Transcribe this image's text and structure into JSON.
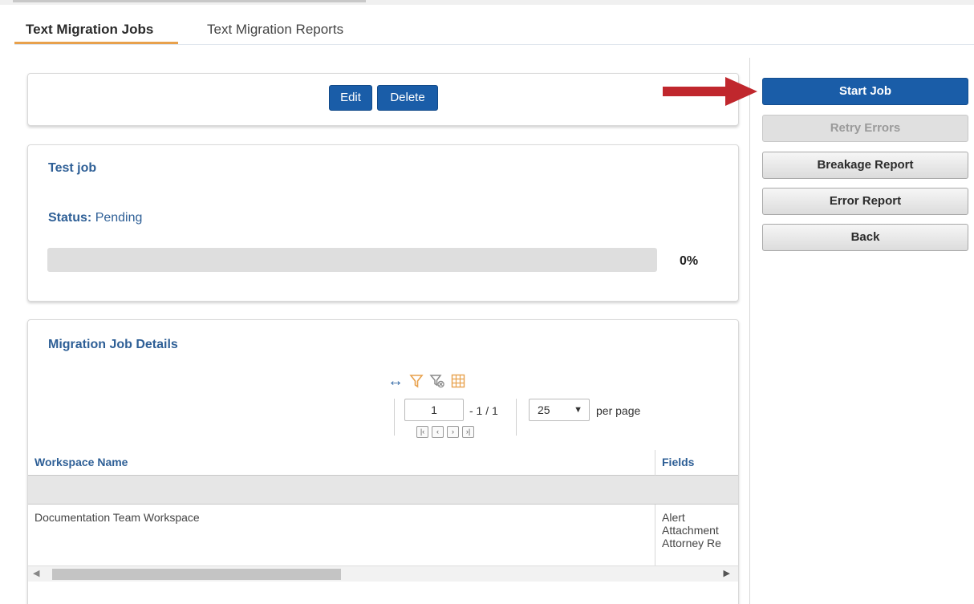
{
  "tabs": [
    {
      "label": "Text Migration Jobs",
      "active": true
    },
    {
      "label": "Text Migration Reports",
      "active": false
    }
  ],
  "actions": {
    "edit_label": "Edit",
    "delete_label": "Delete"
  },
  "job": {
    "name": "Test job",
    "status_label": "Status:",
    "status_value": "Pending",
    "progress_percent": 0,
    "progress_text": "0%"
  },
  "details": {
    "title": "Migration Job Details",
    "toolbar_icons": [
      "resize-columns-icon",
      "filter-icon",
      "clear-filter-icon",
      "column-grid-icon"
    ],
    "pager": {
      "page_value": "1",
      "page_of": "- 1 / 1",
      "page_size": "25",
      "per_page_label": "per page",
      "nav_icons": [
        "first-page-icon",
        "prev-page-icon",
        "next-page-icon",
        "last-page-icon"
      ]
    },
    "columns": [
      "Workspace Name",
      "Fields"
    ],
    "rows": [
      {
        "workspace": "Documentation Team Workspace",
        "fields": [
          "Alert",
          "Attachment",
          "Attorney Re"
        ]
      }
    ]
  },
  "sidebar": {
    "start_label": "Start Job",
    "retry_label": "Retry Errors",
    "breakage_label": "Breakage Report",
    "error_label": "Error Report",
    "back_label": "Back"
  },
  "colors": {
    "primary": "#1a5da8",
    "heading": "#2e5f96",
    "tab_underline": "#e8a14c",
    "annotation_arrow": "#c0272d"
  }
}
